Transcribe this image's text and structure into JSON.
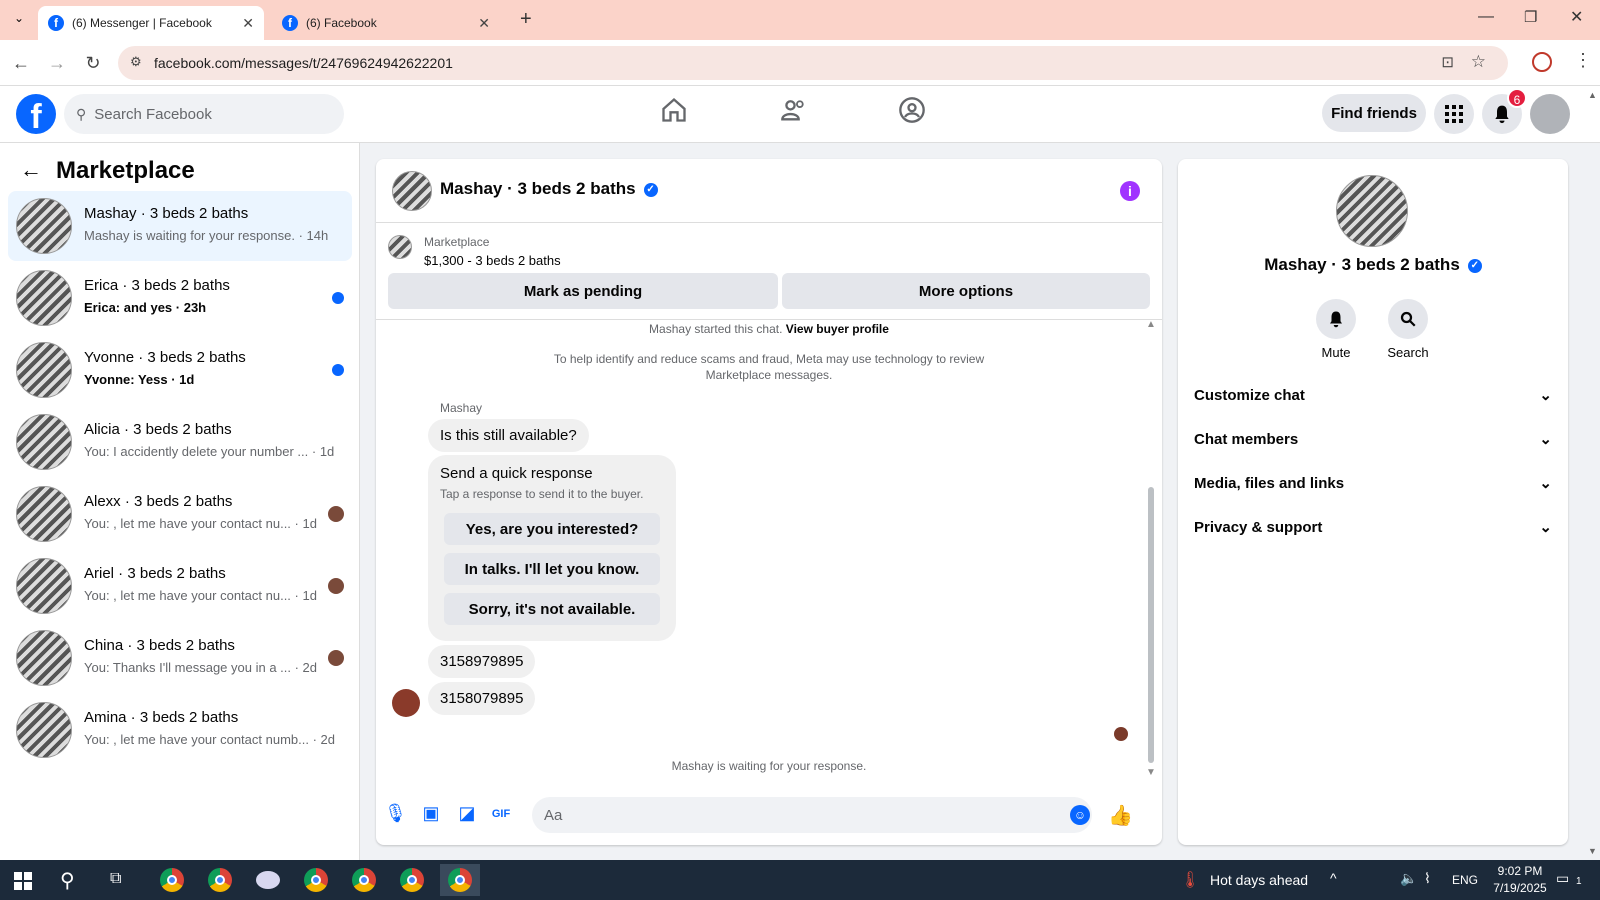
{
  "browser": {
    "tabs": [
      {
        "label": "(6) Messenger | Facebook",
        "active": true
      },
      {
        "label": "(6) Facebook",
        "active": false
      }
    ],
    "url": "facebook.com/messages/t/24769624942622201"
  },
  "header": {
    "search_placeholder": "Search Facebook",
    "find_friends": "Find friends",
    "notification_count": "6"
  },
  "sidebar": {
    "title": "Marketplace",
    "conversations": [
      {
        "name": "Mashay · 3 beds 2 baths",
        "preview": "Mashay is waiting for your response. · 14h",
        "selected": true,
        "unread": false,
        "indicator": "none"
      },
      {
        "name": "Erica · 3 beds 2 baths",
        "preview": "Erica: and yes · 23h",
        "selected": false,
        "unread": true,
        "indicator": "dot"
      },
      {
        "name": "Yvonne · 3 beds 2 baths",
        "preview": "Yvonne: Yess · 1d",
        "selected": false,
        "unread": true,
        "indicator": "dot"
      },
      {
        "name": "Alicia · 3 beds 2 baths",
        "preview": "You: I accidently delete your number ... · 1d",
        "selected": false,
        "unread": false,
        "indicator": "none"
      },
      {
        "name": "Alexx · 3 beds 2 baths",
        "preview": "You: , let me have your contact nu... · 1d",
        "selected": false,
        "unread": false,
        "indicator": "avatar"
      },
      {
        "name": "Ariel · 3 beds 2 baths",
        "preview": "You: , let me have your contact nu... · 1d",
        "selected": false,
        "unread": false,
        "indicator": "avatar"
      },
      {
        "name": "China · 3 beds 2 baths",
        "preview": "You: Thanks I'll message you in a ... · 2d",
        "selected": false,
        "unread": false,
        "indicator": "avatar"
      },
      {
        "name": "Amina · 3 beds 2 baths",
        "preview": "You: , let me have your contact numb... · 2d",
        "selected": false,
        "unread": false,
        "indicator": "none"
      }
    ]
  },
  "chat": {
    "title": "Mashay · 3 beds 2 baths",
    "marketplace_label": "Marketplace",
    "listing": "$1,300 - 3 beds 2 baths",
    "mark_pending": "Mark as pending",
    "more_options": "More options",
    "started_text": "Mashay started this chat.",
    "view_profile": "View buyer profile",
    "disclaimer_line1": "To help identify and reduce scams and fraud, Meta may use technology to review",
    "disclaimer_line2": "Marketplace messages.",
    "sender_name": "Mashay",
    "first_message": "Is this still available?",
    "quick_title": "Send a quick response",
    "quick_sub": "Tap a response to send it to the buyer.",
    "quick_options": [
      "Yes, are you interested?",
      "In talks. I'll let you know.",
      "Sorry, it's not available."
    ],
    "msg2": "3158979895",
    "msg3": "3158079895",
    "waiting": "Mashay is waiting for your response.",
    "composer_placeholder": "Aa"
  },
  "details": {
    "name": "Mashay · 3 beds 2 baths",
    "mute": "Mute",
    "search": "Search",
    "sections": [
      "Customize chat",
      "Chat members",
      "Media, files and links",
      "Privacy & support"
    ]
  },
  "taskbar": {
    "weather": "Hot days ahead",
    "lang": "ENG",
    "time": "9:02 PM",
    "date": "7/19/2025",
    "notif": "1"
  },
  "colors": {
    "accent": "#0866ff",
    "info": "#a033ff",
    "badge": "#e41e3f"
  }
}
